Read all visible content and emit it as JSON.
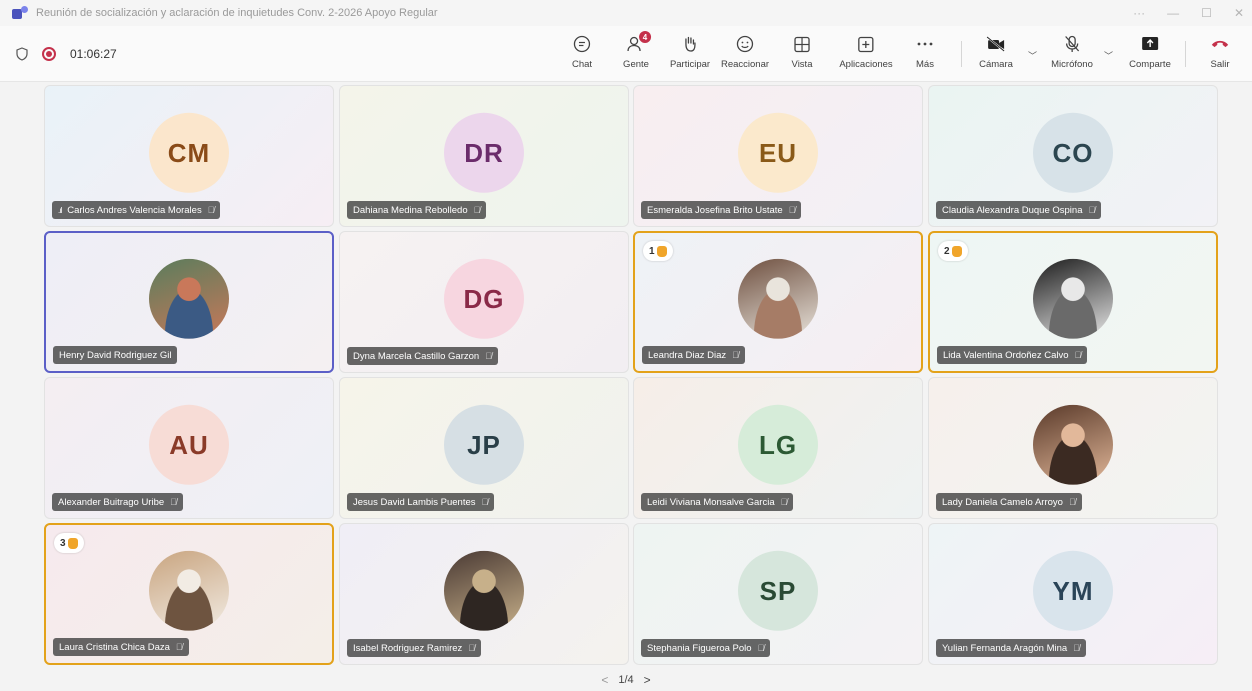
{
  "window": {
    "title": "Reunión de socialización y aclaración de inquietudes Conv. 2-2026 Apoyo Regular",
    "controls": [
      "···",
      "—",
      "☐",
      "✕"
    ]
  },
  "meeting": {
    "timer": "01:06:27"
  },
  "toolbar": {
    "buttons": [
      {
        "label": "Chat",
        "icon": "chat-icon"
      },
      {
        "label": "Gente",
        "icon": "people-icon",
        "badge": "4"
      },
      {
        "label": "Participar",
        "icon": "raise-hand-icon"
      },
      {
        "label": "Reaccionar",
        "icon": "smile-icon"
      },
      {
        "label": "Vista",
        "icon": "grid-view-icon"
      },
      {
        "label": "Aplicaciones",
        "icon": "add-app-icon"
      },
      {
        "label": "Más",
        "icon": "more-icon"
      },
      {
        "label": "Cámara",
        "icon": "camera-off-icon"
      },
      {
        "label": "Micrófono",
        "icon": "mic-off-icon"
      },
      {
        "label": "Comparte",
        "icon": "share-icon"
      },
      {
        "label": "Salir",
        "icon": "leave-icon"
      }
    ]
  },
  "participants": [
    {
      "name": "Carlos Andres Valencia Morales",
      "initials": "CM",
      "avatar_bg": "#fbe6cc",
      "avatar_fg": "#8a4b18",
      "tile_bg": "linear-gradient(135deg,#e9f2f8,#f6eef4)",
      "muted": true,
      "signal": true
    },
    {
      "name": "Dahiana Medina Rebolledo",
      "initials": "DR",
      "avatar_bg": "#ecd6ec",
      "avatar_fg": "#6b2c6b",
      "tile_bg": "linear-gradient(135deg,#f4f4ea,#eef4ee)",
      "muted": true
    },
    {
      "name": "Esmeralda Josefina Brito Ustate",
      "initials": "EU",
      "avatar_bg": "#fbe9cc",
      "avatar_fg": "#8a5a18",
      "tile_bg": "linear-gradient(135deg,#f8eef0,#f2f0f6)",
      "muted": true
    },
    {
      "name": "Claudia Alexandra Duque Ospina",
      "initials": "CO",
      "avatar_bg": "#d7e2e8",
      "avatar_fg": "#2c4650",
      "tile_bg": "linear-gradient(135deg,#eaf4f2,#f2f2f6)",
      "muted": true
    },
    {
      "name": "Henry David Rodriguez Gil",
      "photo": true,
      "photo_colors": [
        "#5a7d5c",
        "#c9785a",
        "#3b5a84"
      ],
      "tile_bg": "linear-gradient(135deg,#eeeef6,#f4f0f2)",
      "speaking": true
    },
    {
      "name": "Dyna Marcela Castillo Garzon",
      "initials": "DG",
      "avatar_bg": "#f7d6e0",
      "avatar_fg": "#8a2a48",
      "tile_bg": "linear-gradient(135deg,#f6f2f2,#f2eef2)",
      "muted": true
    },
    {
      "name": "Leandra Diaz Diaz",
      "photo": true,
      "photo_colors": [
        "#6f5040",
        "#e9e4dc",
        "#a67c66"
      ],
      "tile_bg": "linear-gradient(135deg,#eef2f6,#f6eef2)",
      "muted": true,
      "hand": "1"
    },
    {
      "name": "Lida Valentina Ordoñez Calvo",
      "photo": true,
      "photo_colors": [
        "#1c1c1c",
        "#e8e8e8",
        "#6a6a6a"
      ],
      "tile_bg": "linear-gradient(135deg,#eef6f4,#f2f6f2)",
      "muted": true,
      "hand": "2"
    },
    {
      "name": "Alexander Buitrago Uribe",
      "initials": "AU",
      "avatar_bg": "#f7dcd6",
      "avatar_fg": "#8a3a28",
      "tile_bg": "linear-gradient(135deg,#f4eef2,#eef0f6)",
      "muted": true
    },
    {
      "name": "Jesus David Lambis Puentes",
      "initials": "JP",
      "avatar_bg": "#d6dfe4",
      "avatar_fg": "#2a3f48",
      "tile_bg": "linear-gradient(135deg,#f6f4ea,#f0f2ee)",
      "muted": true
    },
    {
      "name": "Leidi Viviana Monsalve Garcia",
      "initials": "LG",
      "avatar_bg": "#d6ecd9",
      "avatar_fg": "#2c5a34",
      "tile_bg": "linear-gradient(135deg,#f6eee8,#eef2f2)",
      "muted": true
    },
    {
      "name": "Lady Daniela Camelo Arroyo",
      "photo": true,
      "photo_colors": [
        "#5a3a2a",
        "#e2b89a",
        "#3b2a22"
      ],
      "tile_bg": "linear-gradient(135deg,#f6f0ec,#f2f4f2)",
      "muted": true
    },
    {
      "name": "Laura Cristina Chica Daza",
      "photo": true,
      "photo_colors": [
        "#c9a580",
        "#f2ece4",
        "#6e5440"
      ],
      "tile_bg": "linear-gradient(135deg,#f6eaee,#f4eee8)",
      "muted": true,
      "hand": "3"
    },
    {
      "name": "Isabel Rodriguez Ramirez",
      "photo": true,
      "photo_colors": [
        "#4a3a34",
        "#c7b08a",
        "#2e2622"
      ],
      "tile_bg": "linear-gradient(135deg,#f0eef6,#f4f2ee)",
      "muted": true
    },
    {
      "name": "Stephania Figueroa Polo",
      "initials": "SP",
      "avatar_bg": "#d6e6dc",
      "avatar_fg": "#2a4a34",
      "tile_bg": "linear-gradient(135deg,#eef4f2,#f4f2f4)",
      "muted": true
    },
    {
      "name": "Yulian Fernanda Aragón Mina",
      "initials": "YM",
      "avatar_bg": "#d9e4ec",
      "avatar_fg": "#2a4458",
      "tile_bg": "linear-gradient(135deg,#eef4f6,#f6eef6)",
      "muted": true
    }
  ],
  "pager": {
    "label": "1/4",
    "prev": "<",
    "next": ">"
  }
}
